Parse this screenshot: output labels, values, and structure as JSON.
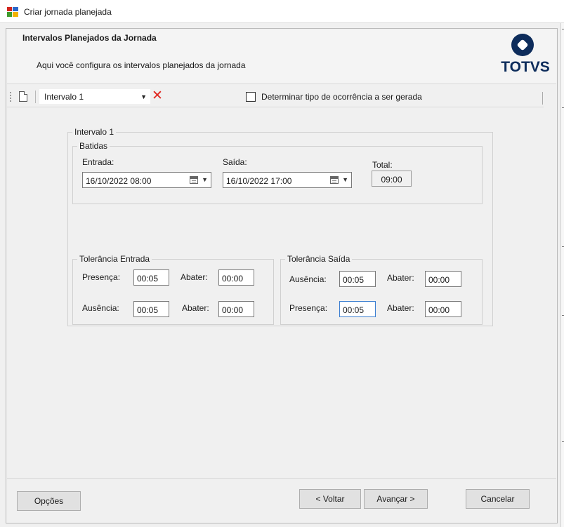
{
  "window": {
    "title": "Criar jornada planejada"
  },
  "header": {
    "title": "Intervalos Planejados da Jornada",
    "description": "Aqui você configura os intervalos planejados da jornada",
    "logo_text": "TOTVS"
  },
  "toolbar": {
    "interval_combo_value": "Intervalo 1",
    "checkbox_label": "Determinar tipo de ocorrência a ser gerada",
    "checkbox_checked": false
  },
  "interval_group": {
    "title": "Intervalo 1",
    "batidas": {
      "title": "Batidas",
      "entrada_label": "Entrada:",
      "entrada_value": "16/10/2022 08:00",
      "saida_label": "Saída:",
      "saida_value": "16/10/2022 17:00",
      "total_label": "Total:",
      "total_value": "09:00"
    },
    "tolerancia_entrada": {
      "title": "Tolerância Entrada",
      "presenca_label": "Presença:",
      "presenca_value": "00:05",
      "abater1_label": "Abater:",
      "abater1_value": "00:00",
      "ausencia_label": "Ausência:",
      "ausencia_value": "00:05",
      "abater2_label": "Abater:",
      "abater2_value": "00:00"
    },
    "tolerancia_saida": {
      "title": "Tolerância Saída",
      "ausencia_label": "Ausência:",
      "ausencia_value": "00:05",
      "abater1_label": "Abater:",
      "abater1_value": "00:00",
      "presenca_label": "Presença:",
      "presenca_value": "00:05",
      "abater2_label": "Abater:",
      "abater2_value": "00:00"
    }
  },
  "footer": {
    "options_label": "Opções",
    "back_label": "< Voltar",
    "next_label": "Avançar >",
    "cancel_label": "Cancelar"
  },
  "icons": {
    "app": "app-icon",
    "new": "new-document-icon",
    "delete": "delete-x-icon",
    "calendar": "calendar-icon"
  },
  "colors": {
    "brand": "#0d2c5b",
    "delete": "#e0261f",
    "focus": "#3c7fd1"
  }
}
